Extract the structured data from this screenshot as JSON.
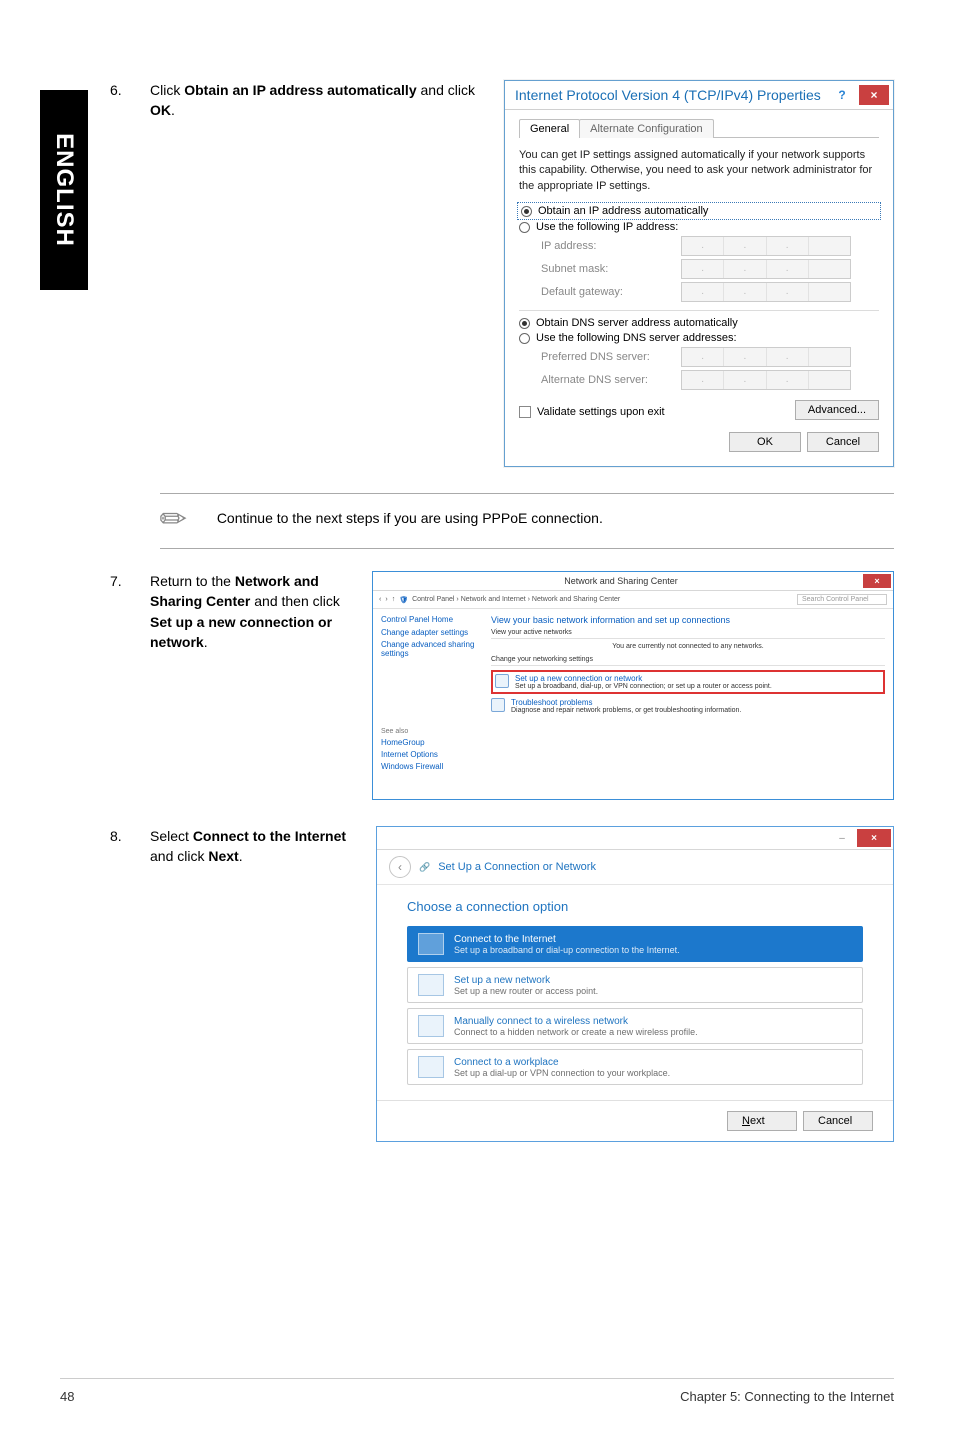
{
  "sideTab": "ENGLISH",
  "step6": {
    "num": "6.",
    "text_prefix": "Click ",
    "bold1": "Obtain an IP address automatically",
    "mid": " and click ",
    "bold2": "OK",
    "suffix": "."
  },
  "ipv4": {
    "title": "Internet Protocol Version 4 (TCP/IPv4) Properties",
    "help": "?",
    "close": "×",
    "tab_general": "General",
    "tab_alt": "Alternate Configuration",
    "desc": "You can get IP settings assigned automatically if your network supports this capability. Otherwise, you need to ask your network administrator for the appropriate IP settings.",
    "r_auto_ip": "Obtain an IP address automatically",
    "r_use_ip": "Use the following IP address:",
    "lbl_ip": "IP address:",
    "lbl_subnet": "Subnet mask:",
    "lbl_gateway": "Default gateway:",
    "r_auto_dns": "Obtain DNS server address automatically",
    "r_use_dns": "Use the following DNS server addresses:",
    "lbl_pref_dns": "Preferred DNS server:",
    "lbl_alt_dns": "Alternate DNS server:",
    "chk_validate": "Validate settings upon exit",
    "btn_adv": "Advanced...",
    "btn_ok": "OK",
    "btn_cancel": "Cancel"
  },
  "note": "Continue to the next steps if you are using PPPoE connection.",
  "step7": {
    "num": "7.",
    "text_a": "Return to the ",
    "bold_a": "Network and Sharing Center",
    "text_b": " and then click ",
    "bold_b": "Set up a new connection or network",
    "suffix": "."
  },
  "nsc": {
    "title": "Network and Sharing Center",
    "crumb": "Control Panel  ›  Network and Internet  ›  Network and Sharing Center",
    "search_ph": "Search Control Panel",
    "side_home": "Control Panel Home",
    "side_adapter": "Change adapter settings",
    "side_sharing": "Change advanced sharing settings",
    "see_also": "See also",
    "see1": "HomeGroup",
    "see2": "Internet Options",
    "see3": "Windows Firewall",
    "main_head": "View your basic network information and set up connections",
    "active_lbl": "View your active networks",
    "active_msg": "You are currently not connected to any networks.",
    "change_lbl": "Change your networking settings",
    "task1_t": "Set up a new connection or network",
    "task1_d": "Set up a broadband, dial-up, or VPN connection; or set up a router or access point.",
    "task2_t": "Troubleshoot problems",
    "task2_d": "Diagnose and repair network problems, or get troubleshooting information."
  },
  "step8": {
    "num": "8.",
    "text_a": "Select ",
    "bold_a": "Connect to the Internet",
    "text_b": " and click ",
    "bold_b": "Next",
    "suffix": "."
  },
  "wiz": {
    "head_back": "‹",
    "head_title": "Set Up a Connection or Network",
    "question": "Choose a connection option",
    "o1_t": "Connect to the Internet",
    "o1_d": "Set up a broadband or dial-up connection to the Internet.",
    "o2_t": "Set up a new network",
    "o2_d": "Set up a new router or access point.",
    "o3_t": "Manually connect to a wireless network",
    "o3_d": "Connect to a hidden network or create a new wireless profile.",
    "o4_t": "Connect to a workplace",
    "o4_d": "Set up a dial-up or VPN connection to your workplace.",
    "btn_next": "Next",
    "btn_cancel": "Cancel",
    "min": "–",
    "close": "×"
  },
  "footer": {
    "page": "48",
    "chapter": "Chapter 5: Connecting to the Internet"
  }
}
